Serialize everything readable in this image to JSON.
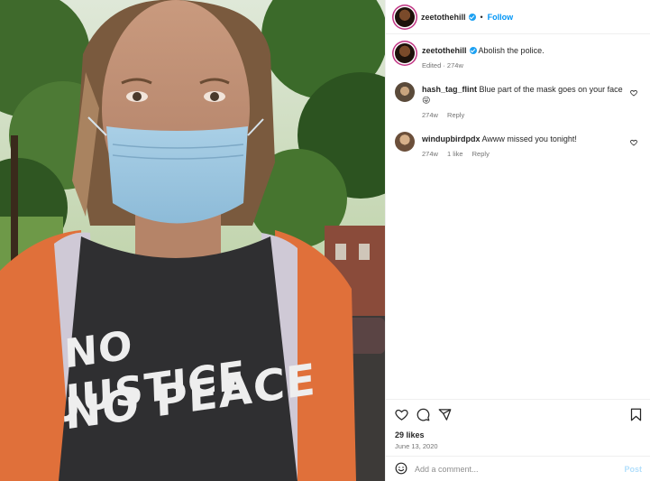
{
  "post": {
    "author": "zeetothehill",
    "follow_label": "Follow",
    "separator": "•",
    "caption": "Abolish the police.",
    "caption_meta": "Edited · 274w",
    "likes": "29 likes",
    "date": "June 13, 2020",
    "photo_text": {
      "line1": "NO JUSTICE",
      "line2": "NO PEACE"
    }
  },
  "comments": [
    {
      "user": "hash_tag_flint",
      "text": "Blue part of the mask goes on your face 😜",
      "age": "274w",
      "likes": "",
      "reply": "Reply"
    },
    {
      "user": "windupbirdpdx",
      "text": "Awww missed you tonight!",
      "age": "274w",
      "likes": "1 like",
      "reply": "Reply"
    }
  ],
  "add_comment": {
    "placeholder": "Add a comment...",
    "post_label": "Post"
  },
  "icons": {
    "like": "heart-icon",
    "comment": "comment-icon",
    "share": "share-icon",
    "save": "bookmark-icon",
    "emoji": "emoji-icon",
    "verified": "verified-badge-icon"
  },
  "colors": {
    "link": "#0095f6",
    "post_disabled": "#b2dffc",
    "meta": "#737373",
    "verified": "#1da1f2"
  }
}
